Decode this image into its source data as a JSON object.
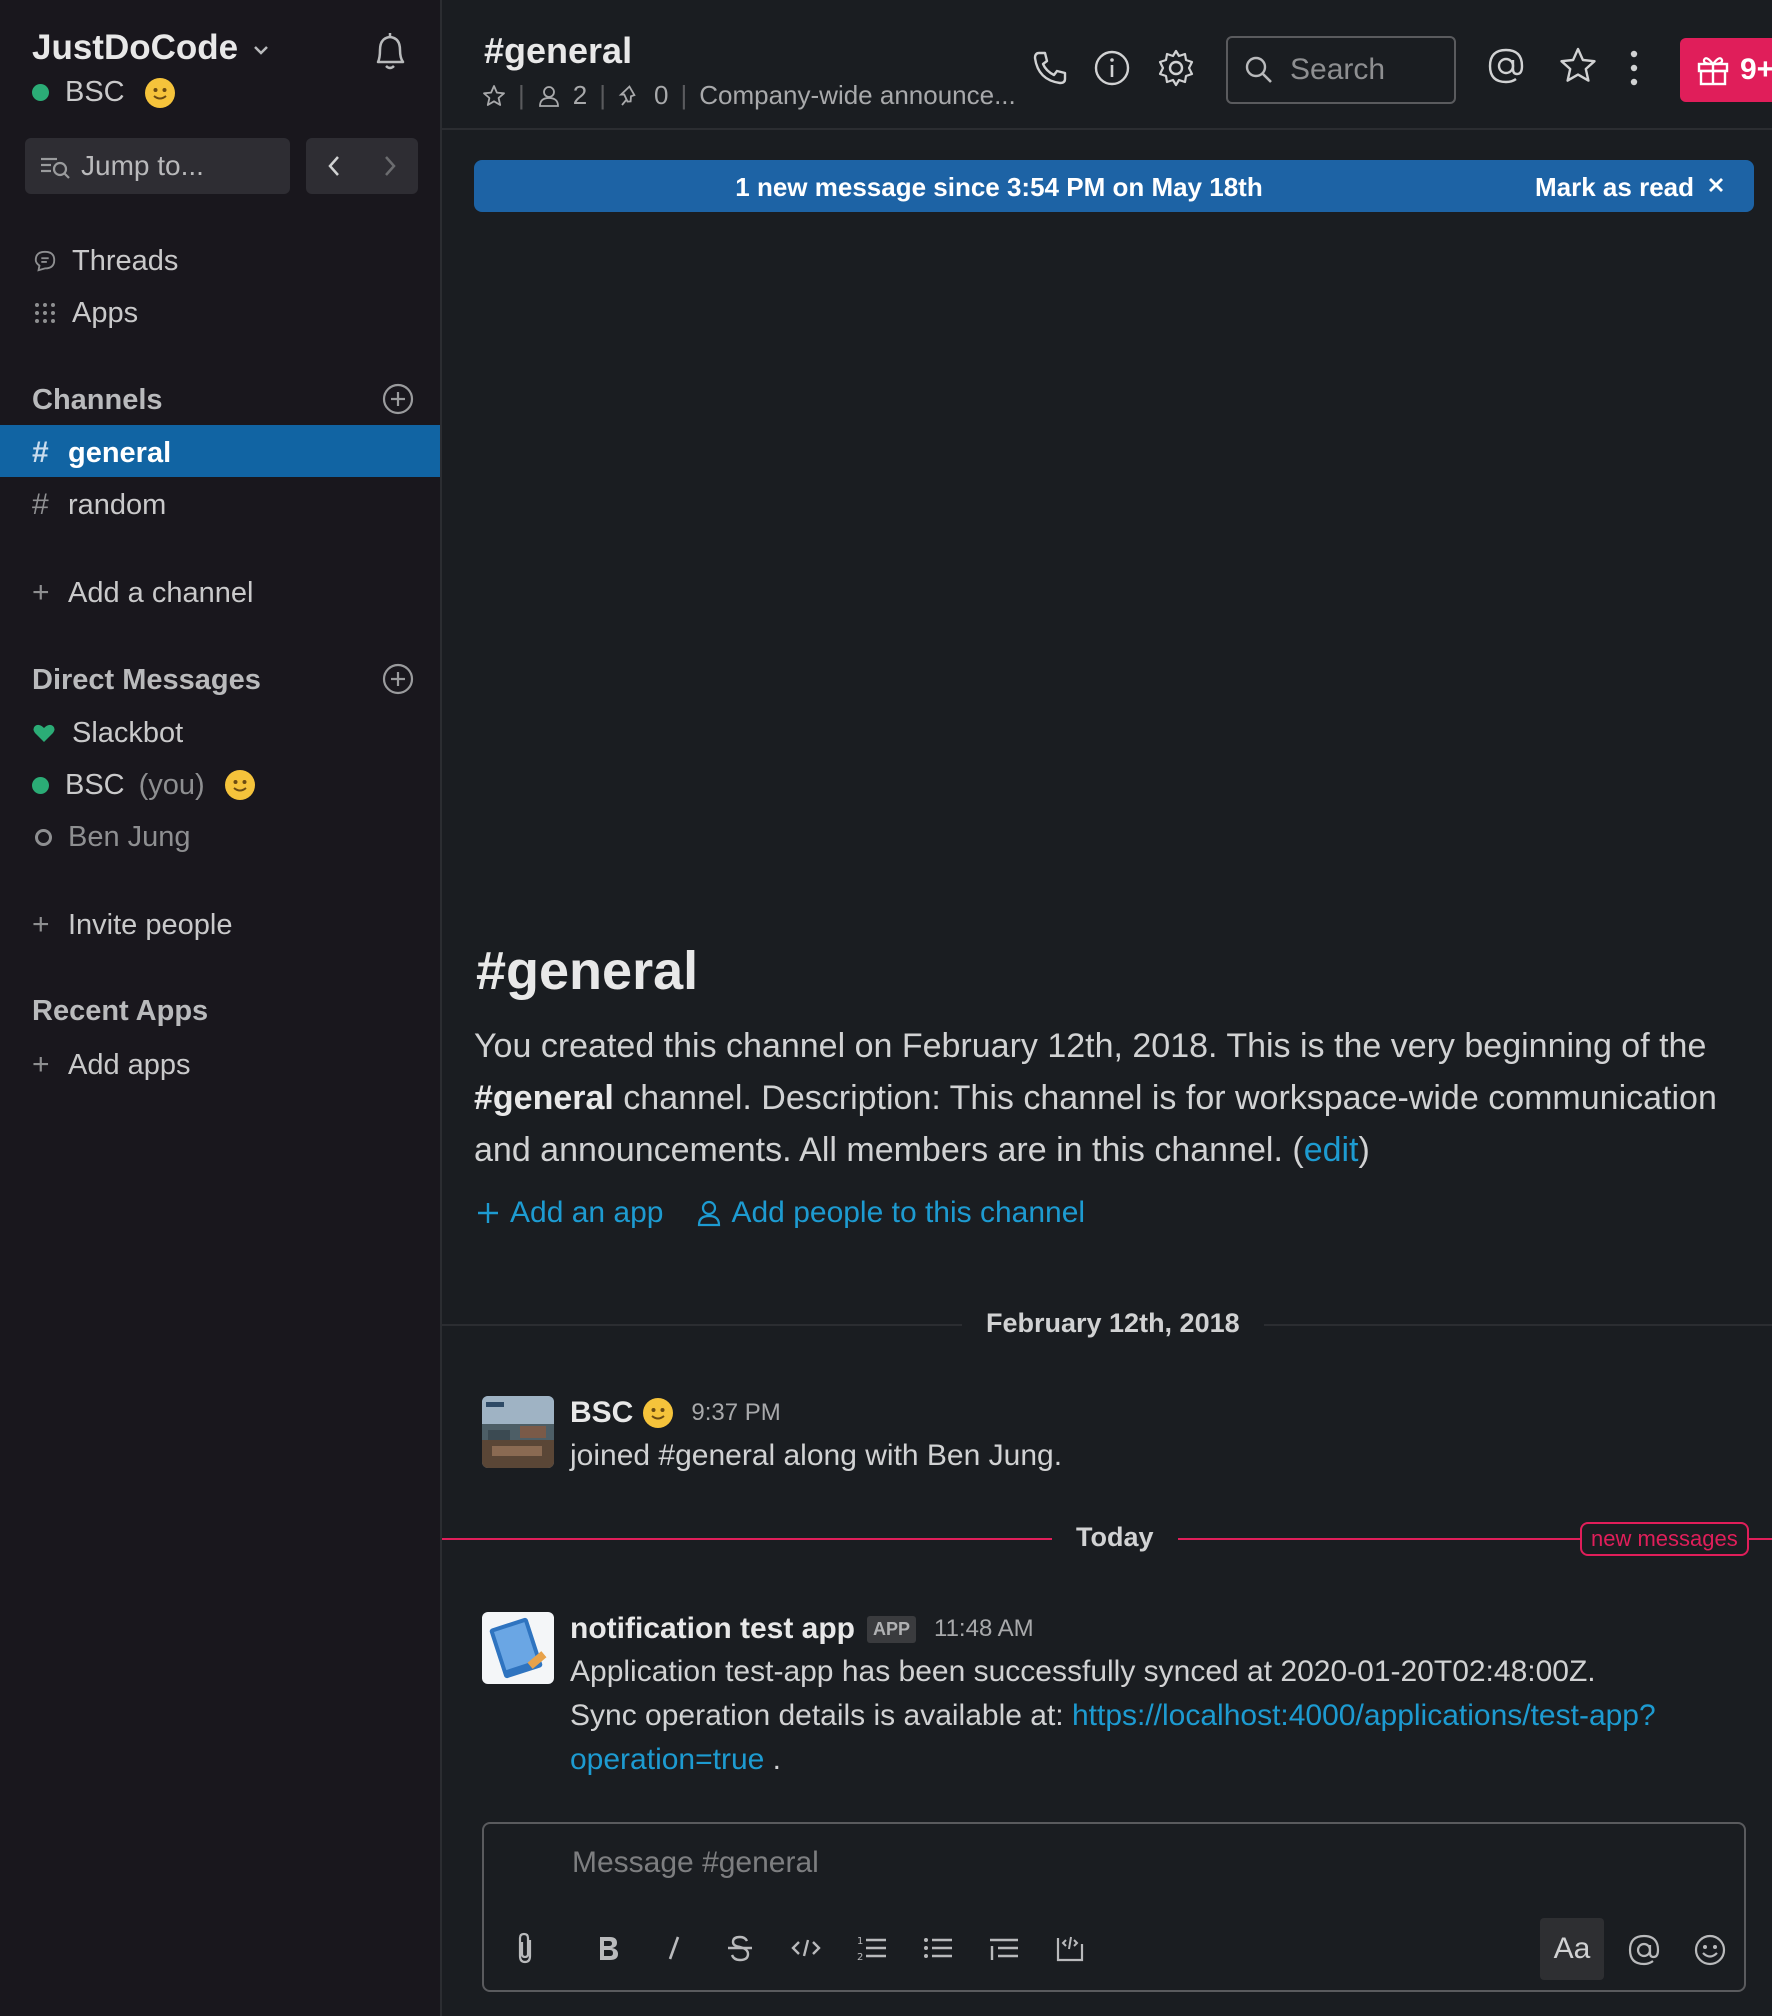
{
  "workspace": {
    "name": "JustDoCode",
    "user": "BSC"
  },
  "sidebar": {
    "jump_placeholder": "Jump to...",
    "threads": "Threads",
    "apps": "Apps",
    "channels_heading": "Channels",
    "channels": [
      {
        "name": "general",
        "active": true
      },
      {
        "name": "random",
        "active": false
      }
    ],
    "add_channel": "Add a channel",
    "dm_heading": "Direct Messages",
    "dms": [
      {
        "name": "Slackbot"
      },
      {
        "name": "BSC",
        "suffix": "(you)"
      },
      {
        "name": "Ben Jung"
      }
    ],
    "invite": "Invite people",
    "recent_apps_heading": "Recent Apps",
    "add_apps": "Add apps",
    "hash": "#",
    "plus": "+"
  },
  "header": {
    "channel_title": "#general",
    "members": "2",
    "pins": "0",
    "topic": "Company-wide announce...",
    "search_placeholder": "Search",
    "notifications_badge": "9+"
  },
  "banner": {
    "message": "1 new message since 3:54 PM on May 18th",
    "mark_read": "Mark as read"
  },
  "intro": {
    "title": "#general",
    "text_1": "You created this channel on February 12th, 2018. This is the very beginning of the ",
    "channel_bold": "#general",
    "text_2": " channel. Description: This channel is for workspace-wide communication and announcements. All members are in this channel. (",
    "edit": "edit",
    "text_3": ")",
    "add_app": "Add an app",
    "add_people": "Add people to this channel"
  },
  "messages": {
    "day1": "February 12th, 2018",
    "msg1": {
      "author": "BSC",
      "time": "9:37 PM",
      "text": "joined #general along with Ben Jung."
    },
    "day2": "Today",
    "new_messages": "new messages",
    "msg2": {
      "author": "notification test app",
      "badge": "APP",
      "time": "11:48 AM",
      "line1": "Application test-app has been successfully synced at 2020-01-20T02:48:00Z.",
      "line2_prefix": "Sync operation details is available at: ",
      "link_part1": "https://localhost:4000/applications/test-app?",
      "link_part2": "operation=true",
      "line3_suffix": " ."
    }
  },
  "composer": {
    "placeholder": "Message #general",
    "format_button": "Aa"
  },
  "colors": {
    "sidebar_bg": "#19171d",
    "main_bg": "#1a1d21",
    "active_channel": "#1164a3",
    "banner": "#1d63a5",
    "link": "#1d9bd1",
    "new_messages": "#e01e5a",
    "presence": "#2bac76"
  }
}
